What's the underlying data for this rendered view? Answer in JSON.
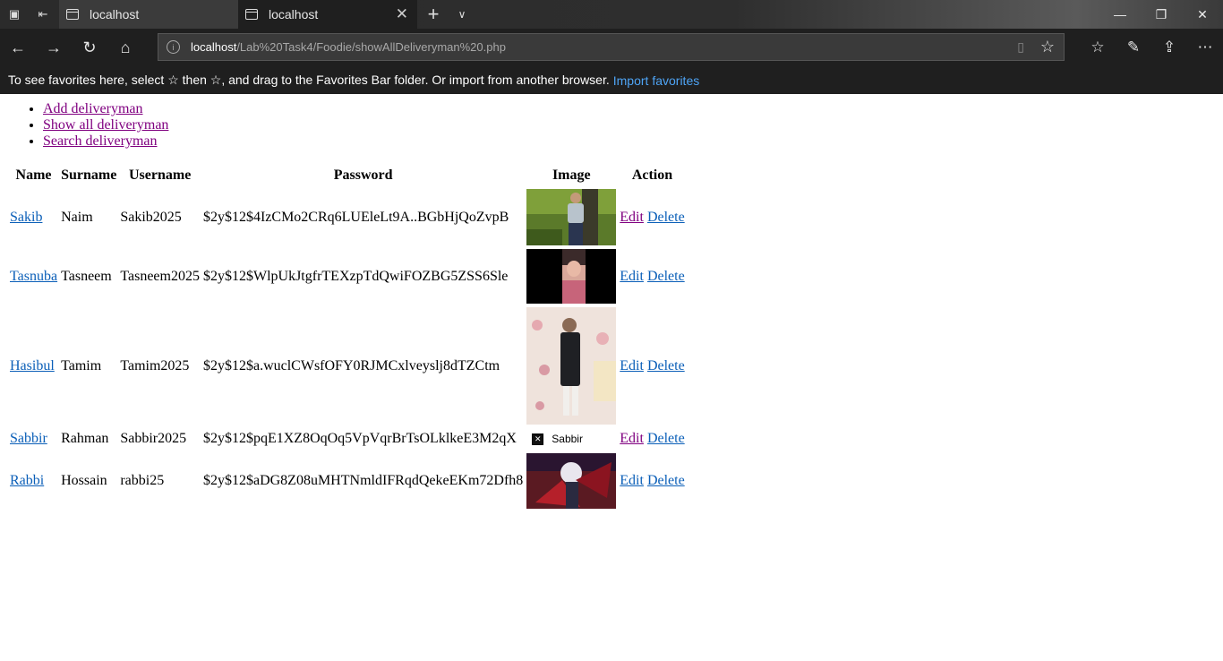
{
  "browser": {
    "tabs": [
      {
        "title": "localhost",
        "active": false
      },
      {
        "title": "localhost",
        "active": true
      }
    ],
    "address": {
      "host": "localhost",
      "path": "/Lab%20Task4/Foodie/showAllDeliveryman%20.php"
    },
    "favorites_bar": {
      "message": "To see favorites here, select ☆ then ☆, and drag to the Favorites Bar folder. Or import from another browser.",
      "import_link": "Import favorites"
    }
  },
  "nav_links": [
    "Add deliveryman",
    "Show all deliveryman",
    "Search deliveryman"
  ],
  "table": {
    "headers": [
      "Name",
      "Surname",
      "Username",
      "Password",
      "Image",
      "Action"
    ],
    "edit_label": "Edit",
    "delete_label": "Delete",
    "rows": [
      {
        "name": "Sakib",
        "surname": "Naim",
        "username": "Sakib2025",
        "password": "$2y$12$4IzCMo2CRq6LUEleLt9A..BGbHjQoZvpB",
        "image_alt": "",
        "image_kind": "photo-outdoor"
      },
      {
        "name": "Tasnuba",
        "surname": "Tasneem",
        "username": "Tasneem2025",
        "password": "$2y$12$WlpUkJtgfrTEXzpTdQwiFOZBG5ZSS6Sle",
        "image_alt": "",
        "image_kind": "photo-portrait"
      },
      {
        "name": "Hasibul",
        "surname": "Tamim",
        "username": "Tamim2025",
        "password": "$2y$12$a.wuclCWsfOFY0RJMCxlveyslj8dTZCtm",
        "image_alt": "",
        "image_kind": "photo-floral"
      },
      {
        "name": "Sabbir",
        "surname": "Rahman",
        "username": "Sabbir2025",
        "password": "$2y$12$pqE1XZ8OqOq5VpVqrBrTsOLklkeE3M2qX",
        "image_alt": "Sabbir",
        "image_kind": "broken"
      },
      {
        "name": "Rabbi",
        "surname": "Hossain",
        "username": "rabbi25",
        "password": "$2y$12$aDG8Z08uMHTNmldIFRqdQekeEKm72Dfh8",
        "image_alt": "",
        "image_kind": "photo-anime"
      }
    ]
  }
}
